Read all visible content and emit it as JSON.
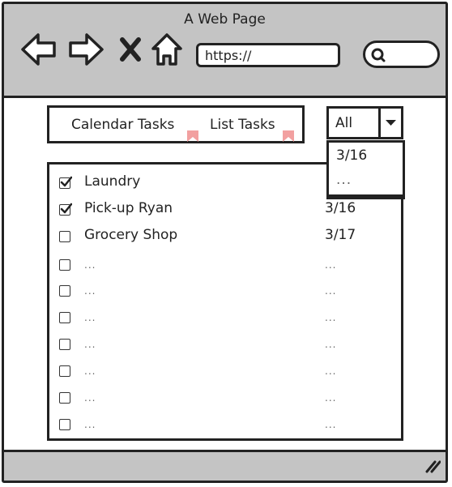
{
  "window": {
    "title": "A Web Page"
  },
  "browser": {
    "url": "https://"
  },
  "tabs": [
    {
      "label": "Calendar Tasks"
    },
    {
      "label": "List Tasks"
    }
  ],
  "filter": {
    "selected": "All",
    "options": [
      "3/16",
      "..."
    ]
  },
  "tasks": [
    {
      "name": "Laundry",
      "date": "",
      "checked": true
    },
    {
      "name": "Pick-up Ryan",
      "date": "3/16",
      "checked": true
    },
    {
      "name": "Grocery Shop",
      "date": "3/17",
      "checked": false
    },
    {
      "name": "...",
      "date": "...",
      "checked": false
    },
    {
      "name": "...",
      "date": "...",
      "checked": false
    },
    {
      "name": "...",
      "date": "...",
      "checked": false
    },
    {
      "name": "...",
      "date": "...",
      "checked": false
    },
    {
      "name": "...",
      "date": "...",
      "checked": false
    },
    {
      "name": "...",
      "date": "...",
      "checked": false
    },
    {
      "name": "...",
      "date": "...",
      "checked": false
    }
  ],
  "colors": {
    "chrome": "#c4c4c4",
    "ink": "#222222",
    "tab_flag": "#f2a0a0"
  },
  "icons": {
    "back": "arrow-left-icon",
    "forward": "arrow-right-icon",
    "stop": "close-icon",
    "home": "home-icon",
    "search": "search-icon",
    "dropdown": "chevron-down-icon",
    "resize": "resize-grip-icon",
    "checkbox": "checkbox-icon"
  }
}
